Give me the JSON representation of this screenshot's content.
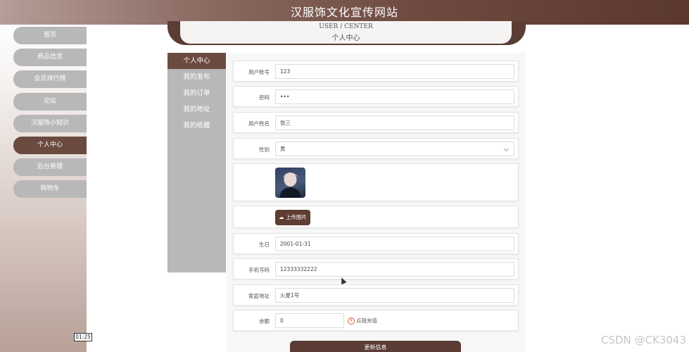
{
  "site": {
    "title": "汉服饰文化宣传网站"
  },
  "nav": {
    "items": [
      {
        "label": "首页"
      },
      {
        "label": "商品信息"
      },
      {
        "label": "会员排行榜"
      },
      {
        "label": "论坛"
      },
      {
        "label": "汉服饰小知识"
      },
      {
        "label": "个人中心",
        "active": true
      },
      {
        "label": "后台管理"
      },
      {
        "label": "购物车"
      }
    ]
  },
  "header": {
    "en": "USER / CENTER",
    "cn": "个人中心"
  },
  "side_menu": {
    "items": [
      {
        "label": "个人中心",
        "active": true
      },
      {
        "label": "我的发布"
      },
      {
        "label": "我的订单"
      },
      {
        "label": "我的地址"
      },
      {
        "label": "我的收藏"
      }
    ]
  },
  "form": {
    "username": {
      "label": "用户账号",
      "value": "123"
    },
    "password": {
      "label": "密码",
      "value": "•••"
    },
    "realname": {
      "label": "用户姓名",
      "value": "张三"
    },
    "gender": {
      "label": "性别",
      "value": "男"
    },
    "upload_label": "上传图片",
    "birthday": {
      "label": "生日",
      "value": "2001-01-31"
    },
    "phone": {
      "label": "手机号码",
      "value": "12333332222"
    },
    "address": {
      "label": "家庭地址",
      "value": "火星1号"
    },
    "balance": {
      "label": "余额",
      "value": "0"
    },
    "recharge_label": "点我充值",
    "submit_label": "更新信息"
  },
  "overlay": {
    "timer": "01:25",
    "watermark": "CSDN @CK3043"
  },
  "colors": {
    "accent": "#5b3d35",
    "nav_inactive": "#b8b8b8",
    "active": "#6b4a40"
  }
}
